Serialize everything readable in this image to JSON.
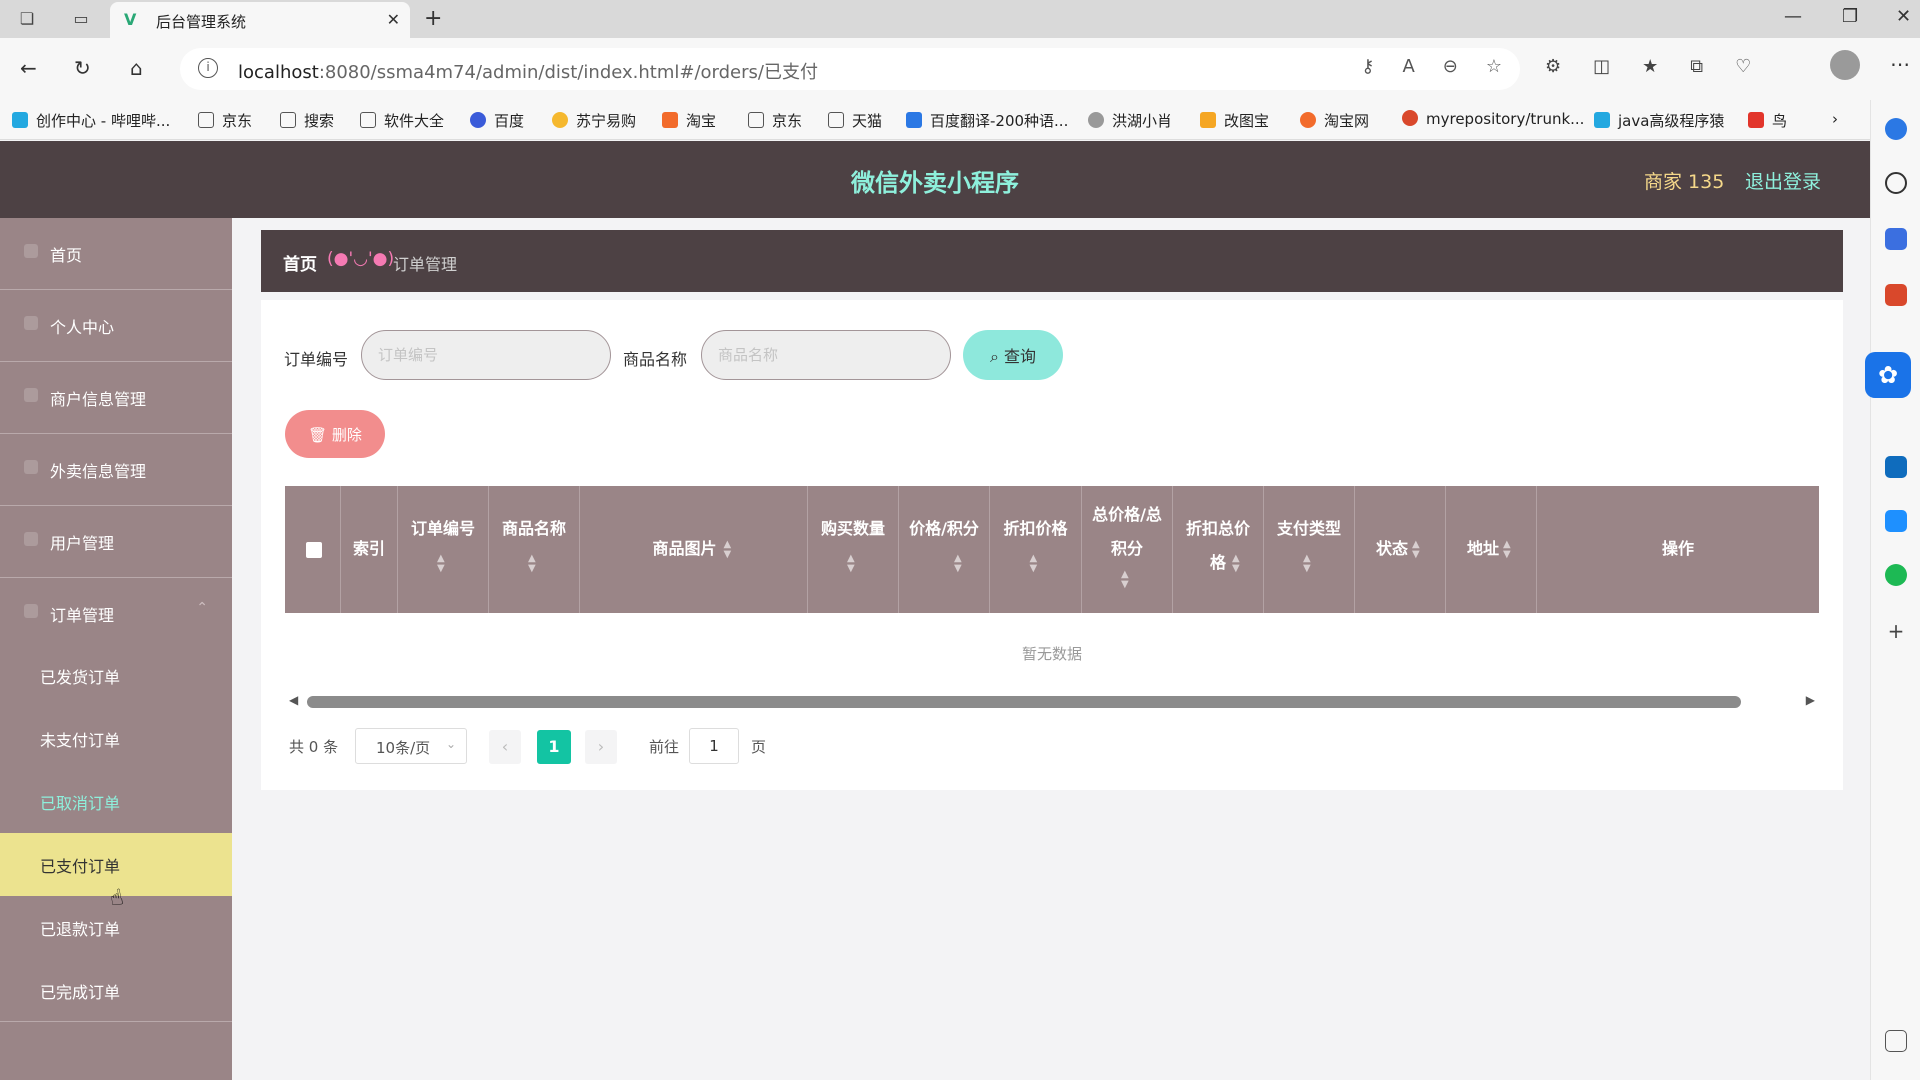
{
  "browser": {
    "tab_title": "后台管理系统",
    "url_host": "localhost",
    "url_rest": ":8080/ssma4m74/admin/dist/index.html#/orders/已支付",
    "bookmarks": [
      "创作中心 - 哔哩哔...",
      "京东",
      "搜索",
      "软件大全",
      "百度",
      "苏宁易购",
      "淘宝",
      "京东",
      "天猫",
      "百度翻译-200种语...",
      "洪湖小肖",
      "改图宝",
      "淘宝网",
      "myrepository/trunk...",
      "java高级程序猿",
      "鸟"
    ]
  },
  "header": {
    "title": "微信外卖小程序",
    "user": "商家 135",
    "logout": "退出登录"
  },
  "sidebar": {
    "items": [
      {
        "label": "首页"
      },
      {
        "label": "个人中心"
      },
      {
        "label": "商户信息管理"
      },
      {
        "label": "外卖信息管理"
      },
      {
        "label": "用户管理"
      },
      {
        "label": "订单管理"
      }
    ],
    "sub_items": [
      {
        "label": "已发货订单"
      },
      {
        "label": "未支付订单"
      },
      {
        "label": "已取消订单"
      },
      {
        "label": "已支付订单"
      },
      {
        "label": "已退款订单"
      },
      {
        "label": "已完成订单"
      }
    ]
  },
  "breadcrumb": {
    "home": "首页",
    "separator": "(●'◡'●)",
    "current": "订单管理"
  },
  "search": {
    "order_no_label": "订单编号",
    "order_no_placeholder": "订单编号",
    "goods_name_label": "商品名称",
    "goods_name_placeholder": "商品名称",
    "query_button": "查询"
  },
  "actions": {
    "delete_button": "删除"
  },
  "table": {
    "columns": [
      {
        "label": "索引"
      },
      {
        "label": "订单编号"
      },
      {
        "label": "商品名称"
      },
      {
        "label": "商品图片"
      },
      {
        "label": "购买数量"
      },
      {
        "label": "价格/积分"
      },
      {
        "label": "折扣价格"
      },
      {
        "label": "总价格/总积分"
      },
      {
        "label": "折扣总价格"
      },
      {
        "label": "支付类型"
      },
      {
        "label": "状态"
      },
      {
        "label": "地址"
      },
      {
        "label": "操作"
      }
    ],
    "empty_text": "暂无数据"
  },
  "pagination": {
    "total": "共 0 条",
    "page_size": "10条/页",
    "current_page": "1",
    "goto_label": "前往",
    "goto_value": "1",
    "page_unit": "页"
  },
  "colors": {
    "header_bg": "#4d4144",
    "sidebar_bg": "#9a8587",
    "accent_teal": "#8ef0dc",
    "active_item": "#ece38f",
    "delete_red": "#f28d8d",
    "page_active": "#13c4a3"
  }
}
